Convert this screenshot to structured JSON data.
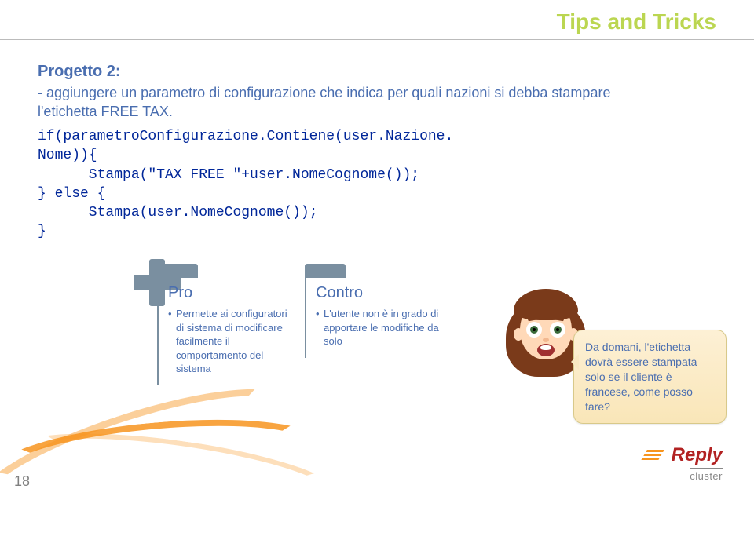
{
  "header": {
    "title": "Tips and Tricks"
  },
  "section": {
    "project": "Progetto 2:",
    "desc": "  - aggiungere un parametro di configurazione che indica per quali nazioni si debba stampare l'etichetta FREE TAX."
  },
  "code": {
    "l1": "if(parametroConfigurazione.Contiene(user.Nazione.",
    "l2": "Nome)){",
    "l3": "      Stampa(\"TAX FREE \"+user.NomeCognome());",
    "l4": "} else {",
    "l5": "      Stampa(user.NomeCognome());",
    "l6": "}"
  },
  "pro": {
    "heading": "Pro",
    "item": "Permette ai configuratori di sistema di modificare facilmente il comportamento del sistema"
  },
  "contro": {
    "heading": "Contro",
    "item": "L'utente non è in grado di apportare le modifiche da solo"
  },
  "bubble": {
    "text": "Da domani, l'etichetta dovrà essere stampata solo se il cliente è francese, come posso fare?"
  },
  "footer": {
    "page": "18",
    "brand": "Reply",
    "sub": "cluster"
  }
}
